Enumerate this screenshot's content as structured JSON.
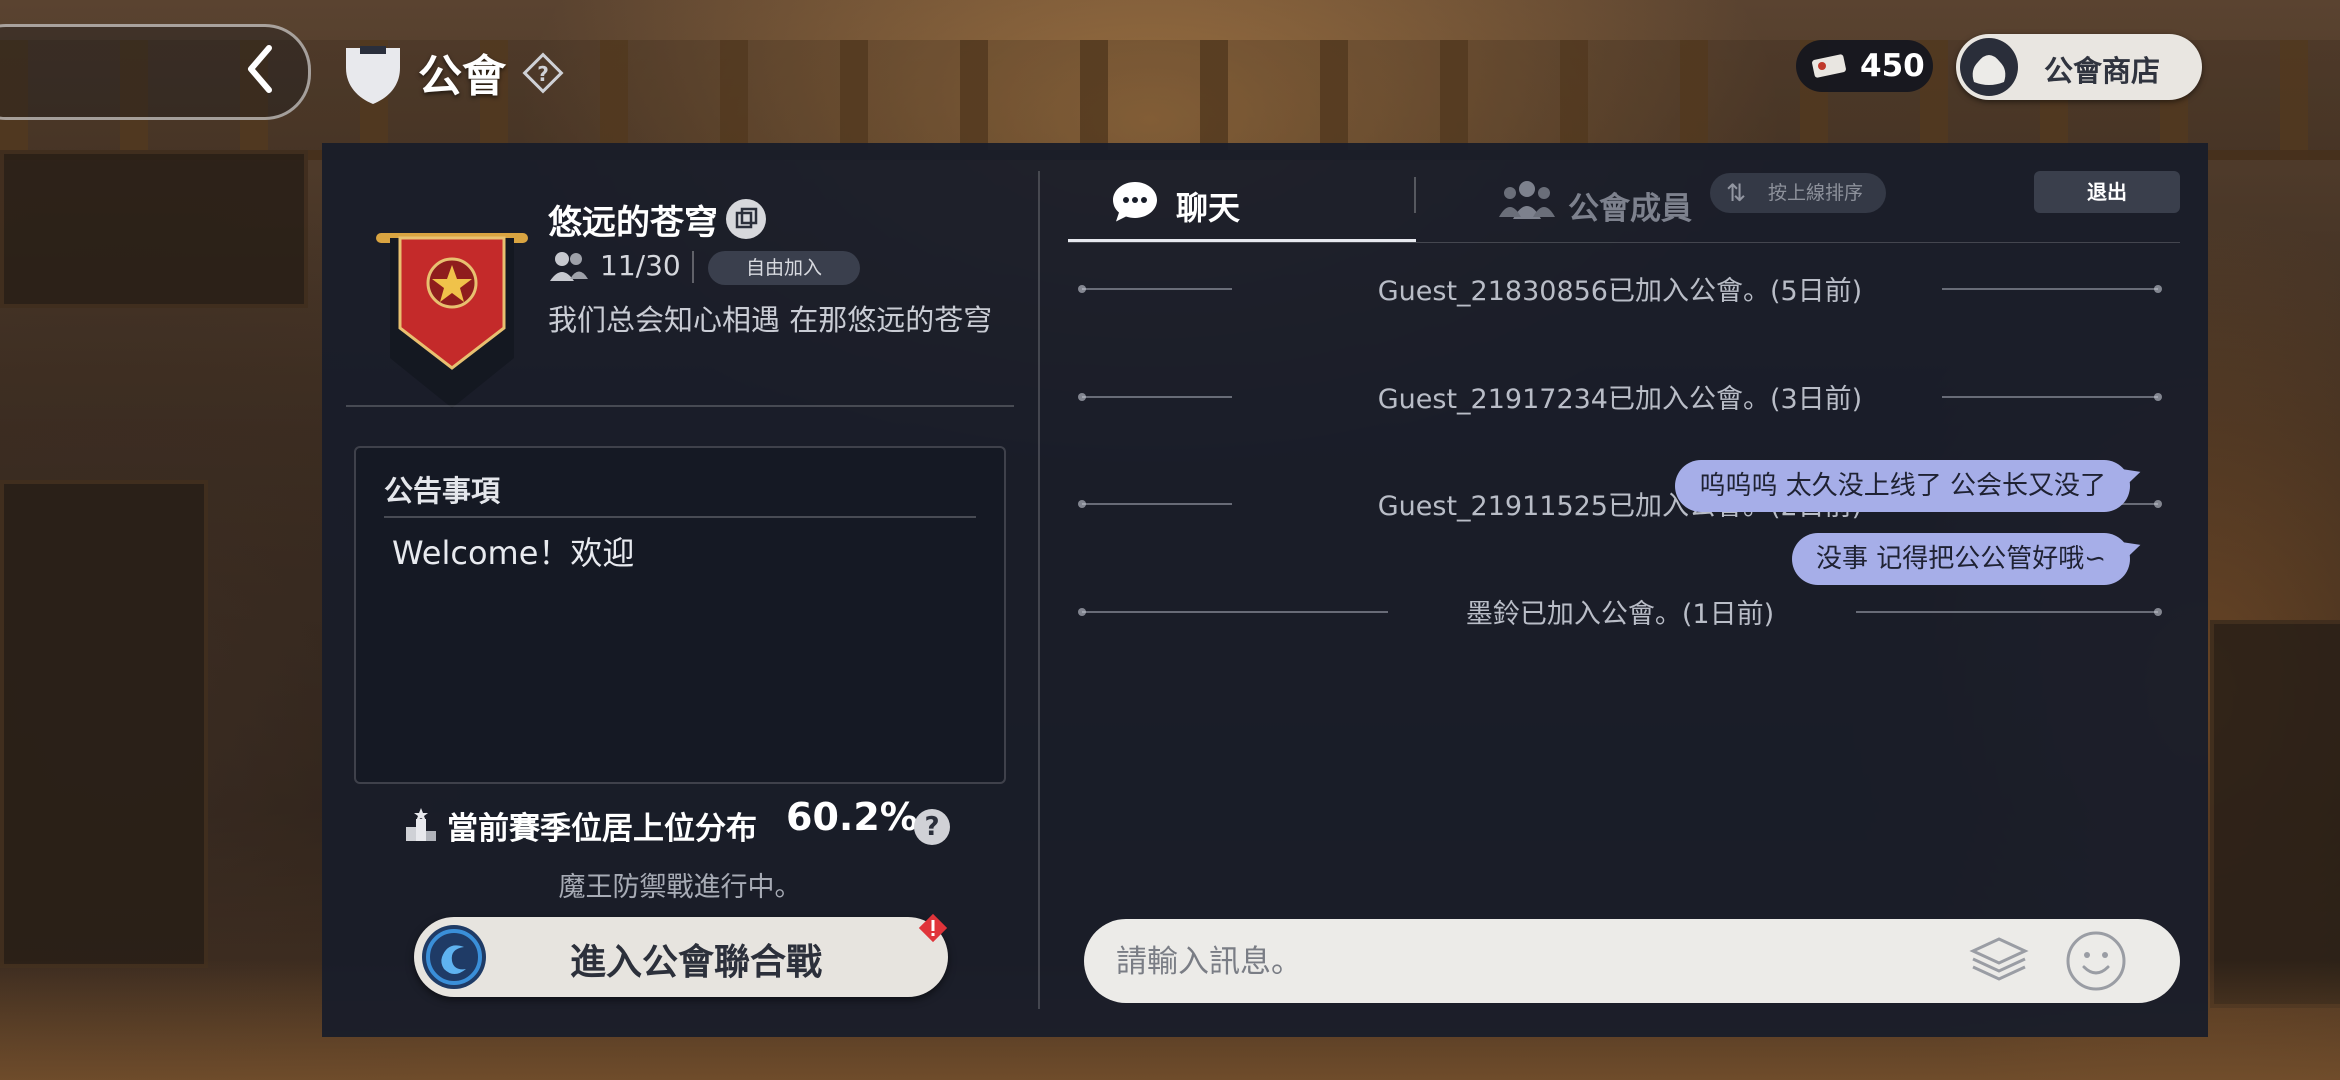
{
  "header": {
    "title": "公會",
    "currency_value": "450",
    "shop_label": "公會商店"
  },
  "guild": {
    "name": "悠远的苍穹",
    "member_count": "11/30",
    "join_mode": "自由加入",
    "motto": "我们总会知心相遇 在那悠远的苍穹"
  },
  "notice": {
    "title": "公告事項",
    "body": "Welcome！欢迎"
  },
  "season": {
    "label": "當前賽季位居上位分布",
    "percent": "60.2%",
    "status": "魔王防禦戰進行中。"
  },
  "war_button_label": "進入公會聯合戰",
  "tabs": {
    "chat": "聊天",
    "members": "公會成員",
    "sort_label": "按上線排序",
    "exit": "退出"
  },
  "chat": {
    "system_messages": [
      "Guest_21830856已加入公會。(5日前)",
      "Guest_21917234已加入公會。(3日前)",
      "Guest_21911525已加入公會。(2日前)",
      "墨鈴已加入公會。(1日前)"
    ],
    "user_messages": [
      "呜呜呜 太久没上线了 公会长又没了",
      "没事 记得把公公管好哦∽"
    ],
    "input_placeholder": "請輸入訊息。"
  },
  "colors": {
    "panel": "#181d29",
    "bubble": "#a6aee8",
    "banner_red": "#c42a2a",
    "banner_gold": "#d9a441"
  }
}
